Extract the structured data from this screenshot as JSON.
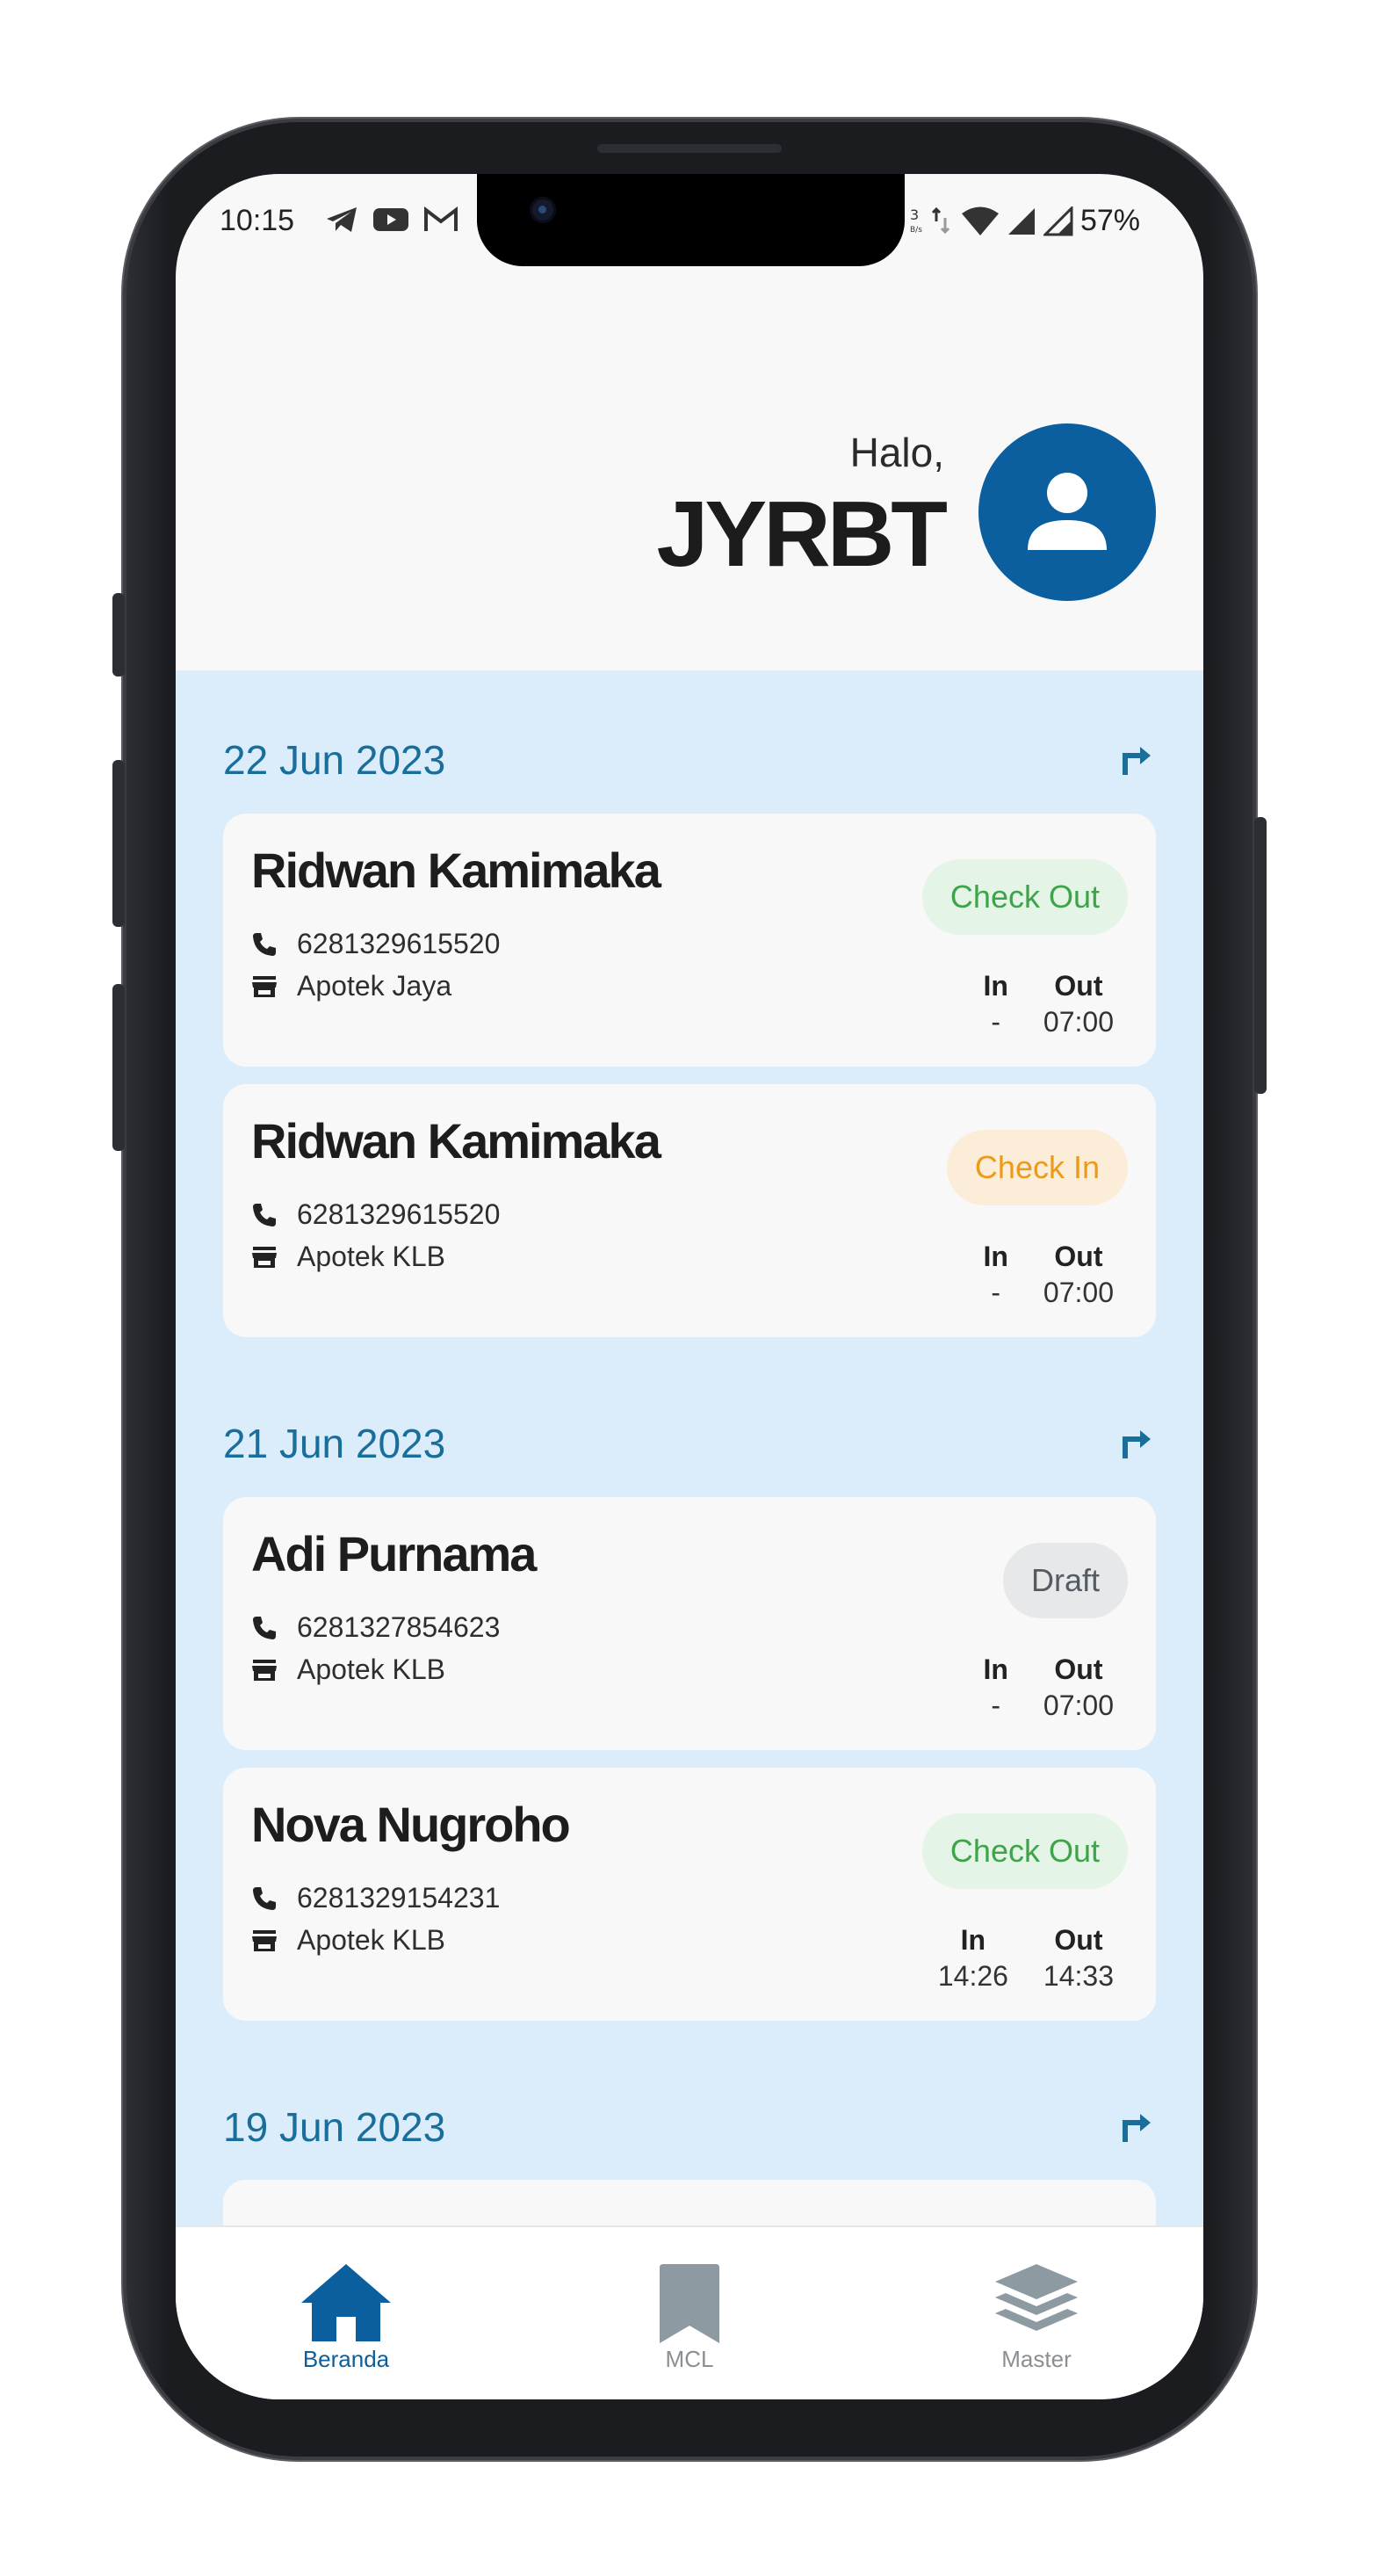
{
  "status_bar": {
    "time": "10:15",
    "battery": "57%"
  },
  "header": {
    "greeting": "Halo,",
    "user_name": "JYRBT"
  },
  "groups": [
    {
      "date": "22 Jun 2023",
      "entries": [
        {
          "name": "Ridwan Kamimaka",
          "phone": "6281329615520",
          "store": "Apotek Jaya",
          "status": "Check Out",
          "in_label": "In",
          "out_label": "Out",
          "in_time": "-",
          "out_time": "07:00"
        },
        {
          "name": "Ridwan Kamimaka",
          "phone": "6281329615520",
          "store": "Apotek KLB",
          "status": "Check In",
          "in_label": "In",
          "out_label": "Out",
          "in_time": "-",
          "out_time": "07:00"
        }
      ]
    },
    {
      "date": "21 Jun 2023",
      "entries": [
        {
          "name": "Adi Purnama",
          "phone": "6281327854623",
          "store": "Apotek KLB",
          "status": "Draft",
          "in_label": "In",
          "out_label": "Out",
          "in_time": "-",
          "out_time": "07:00"
        },
        {
          "name": "Nova Nugroho",
          "phone": "6281329154231",
          "store": "Apotek KLB",
          "status": "Check Out",
          "in_label": "In",
          "out_label": "Out",
          "in_time": "14:26",
          "out_time": "14:33"
        }
      ]
    },
    {
      "date": "19 Jun 2023",
      "entries": []
    }
  ],
  "nav": {
    "home": {
      "label": "Beranda",
      "icon": "home-icon"
    },
    "mcl": {
      "label": "MCL",
      "icon": "bookmark-icon"
    },
    "master": {
      "label": "Master",
      "icon": "layers-icon"
    }
  },
  "colors": {
    "accent": "#0b5f9e",
    "list_background": "#dbedfa",
    "date_text": "#1a6e9c",
    "check_out": "#3ea34a",
    "check_in": "#ec9a1c",
    "draft": "#555b62"
  }
}
